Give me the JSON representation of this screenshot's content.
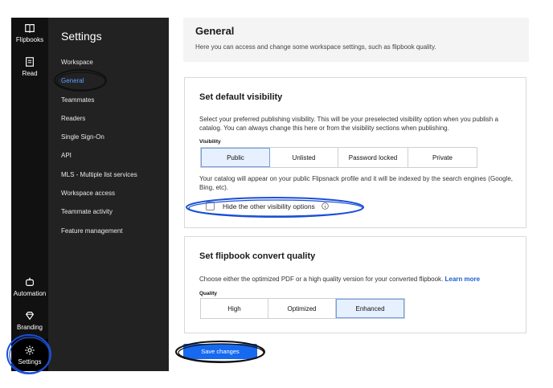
{
  "rail": {
    "flipbooks": "Flipbooks",
    "read": "Read",
    "automation": "Automation",
    "branding": "Branding",
    "settings": "Settings"
  },
  "sidebar": {
    "title": "Settings",
    "items": [
      {
        "label": "Workspace"
      },
      {
        "label": "General"
      },
      {
        "label": "Teammates"
      },
      {
        "label": "Readers"
      },
      {
        "label": "Single Sign-On"
      },
      {
        "label": "API"
      },
      {
        "label": "MLS - Multiple list services"
      },
      {
        "label": "Workspace access"
      },
      {
        "label": "Teammate activity"
      },
      {
        "label": "Feature management"
      }
    ]
  },
  "header": {
    "title": "General",
    "subtitle": "Here you can access and change some workspace settings, such as flipbook quality."
  },
  "visibility_card": {
    "title": "Set default visibility",
    "description": "Select your preferred publishing visibility. This will be your preselected visibility option when you publish a catalog. You can always change this here or from the visibility sections when publishing.",
    "label": "Visibility",
    "options": [
      "Public",
      "Unlisted",
      "Password locked",
      "Private"
    ],
    "selected": "Public",
    "note": "Your catalog will appear on your public Flipsnack profile and it will be indexed by the search engines (Google, Bing, etc).",
    "checkbox_label": "Hide the other visibility options"
  },
  "quality_card": {
    "title": "Set flipbook convert quality",
    "description": "Choose either the optimized PDF or a high quality version for your converted flipbook.",
    "learn_more": "Learn more",
    "label": "Quality",
    "options": [
      "High",
      "Optimized",
      "Enhanced"
    ],
    "selected": "Enhanced"
  },
  "actions": {
    "save_label": "Save changes"
  },
  "colors": {
    "accent": "#1769f0",
    "highlight": "#1a4fd6",
    "highlight_dark": "#111111"
  }
}
